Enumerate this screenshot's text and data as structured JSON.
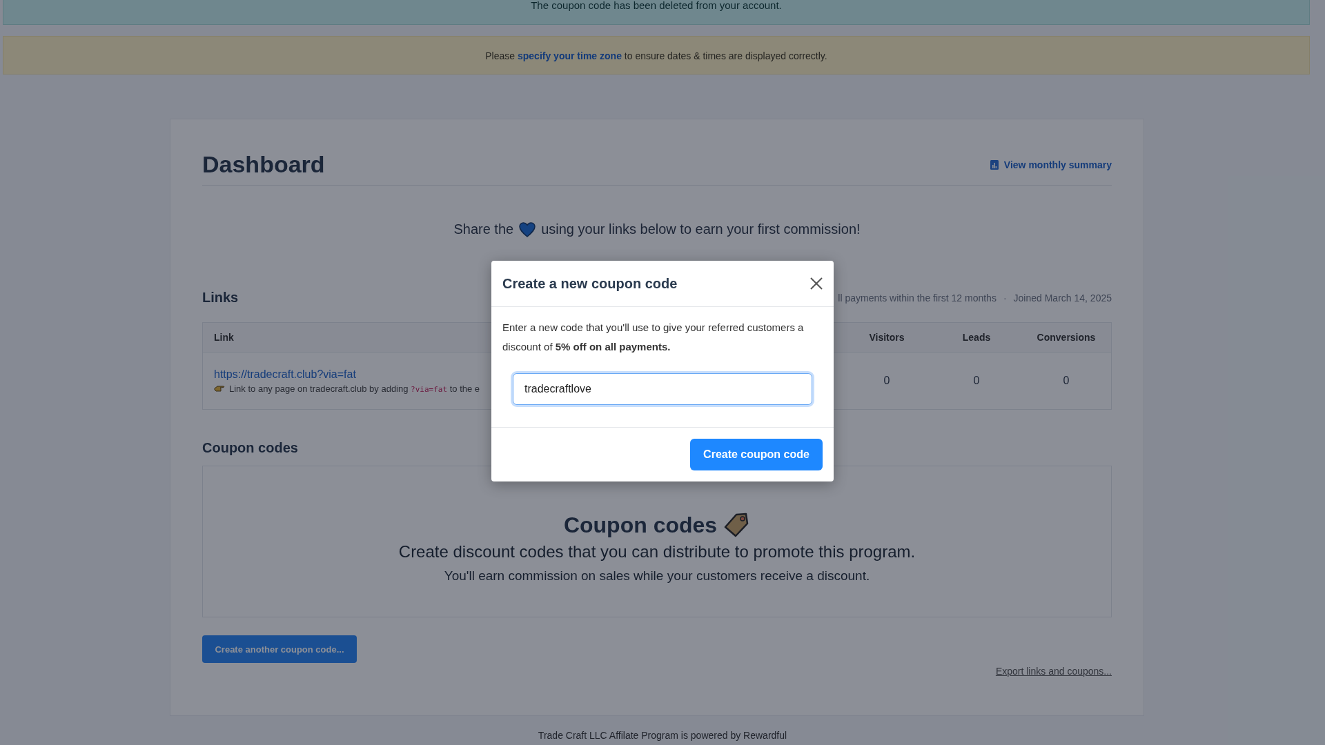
{
  "notice": {
    "text": "The coupon code has been deleted from your account."
  },
  "timezone_banner": {
    "before": "Please",
    "link": "specify your time zone",
    "after": "to ensure dates & times are displayed correctly."
  },
  "dashboard": {
    "title": "Dashboard",
    "summary_link": "View monthly summary",
    "share_before": "Share the",
    "share_after": "using your links below to earn your first commission!"
  },
  "links": {
    "heading": "Links",
    "meta_separator": "·",
    "meta": [
      "ll payments within the first 12 months",
      "Joined March 14, 2025"
    ],
    "columns": [
      "Link",
      "Visitors",
      "Leads",
      "Conversions"
    ],
    "rows": [
      {
        "url": "https://tradecraft.club?via=fat",
        "hint_before": "Link to any page on tradecraft.club by adding",
        "hint_code": "?via=fat",
        "hint_after": "to the e",
        "visitors": "0",
        "leads": "0",
        "conversions": "0"
      }
    ]
  },
  "coupons": {
    "heading": "Coupon codes",
    "empty_title": "Coupon codes",
    "empty_text": "Create discount codes that you can distribute to promote this program.",
    "empty_subtext": "You'll earn commission on sales while your customers receive a discount.",
    "button": "Create another coupon code..."
  },
  "export_link": "Export links and coupons...",
  "footer": "Trade Craft LLC Affilate Program is powered by Rewardful",
  "modal": {
    "title": "Create a new coupon code",
    "text": "Enter a new code that you'll use to give your referred customers a discount of **5% off on all payments.**",
    "input_value": "tradecraftlove",
    "button": "Create coupon code"
  }
}
